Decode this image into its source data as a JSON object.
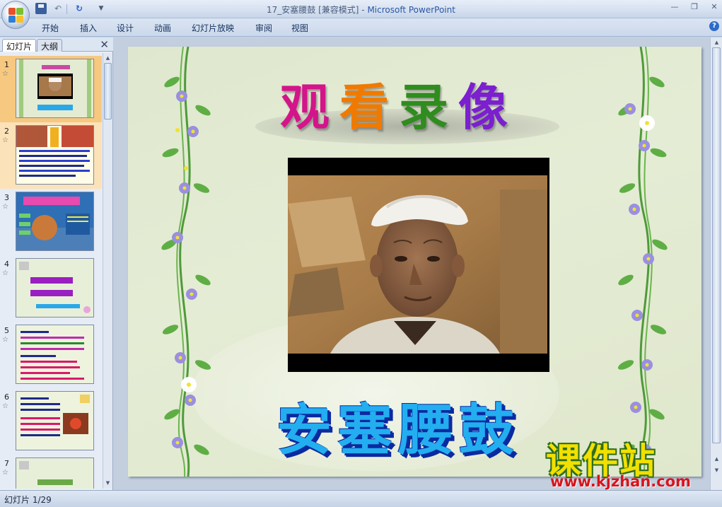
{
  "window": {
    "title_doc": "17_安塞腰鼓 [兼容模式]",
    "title_sep": " - ",
    "title_app": "Microsoft PowerPoint"
  },
  "ribbon": {
    "tabs": [
      "开始",
      "插入",
      "设计",
      "动画",
      "幻灯片放映",
      "审阅",
      "视图"
    ]
  },
  "pane": {
    "tab_slides": "幻灯片",
    "tab_outline": "大纲",
    "thumbnails": [
      {
        "number": "1"
      },
      {
        "number": "2"
      },
      {
        "number": "3"
      },
      {
        "number": "4"
      },
      {
        "number": "5"
      },
      {
        "number": "6"
      },
      {
        "number": "7"
      }
    ]
  },
  "slide": {
    "title_chars": [
      "观",
      "看",
      "录",
      "像"
    ],
    "title_colors": [
      "#d4148a",
      "#f07a00",
      "#2f8c1e",
      "#7b1fd0"
    ],
    "main_title": "安塞腰鼓"
  },
  "watermark": {
    "brand": "课件站",
    "url": "www.kjzhan.com"
  },
  "status": {
    "slide_indicator": "幻灯片 1/29"
  },
  "icons": [
    "office-button-icon",
    "save-icon",
    "undo-icon",
    "redo-icon",
    "customize-arrow-icon",
    "minimize-icon",
    "maximize-icon",
    "close-icon",
    "help-icon",
    "pane-close-icon"
  ]
}
